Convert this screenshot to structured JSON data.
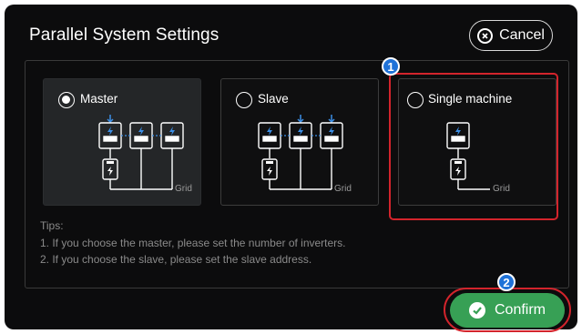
{
  "dialog": {
    "title": "Parallel System Settings",
    "cancel_label": "Cancel",
    "confirm_label": "Confirm"
  },
  "options": [
    {
      "label": "Master",
      "selected": true,
      "grid_label": "Grid",
      "inverters": 3
    },
    {
      "label": "Slave",
      "selected": false,
      "grid_label": "Grid",
      "inverters": 3
    },
    {
      "label": "Single machine",
      "selected": false,
      "grid_label": "Grid",
      "inverters": 1
    }
  ],
  "tips": {
    "heading": "Tips:",
    "line1": "1. If you choose the master, please set the number of inverters.",
    "line2": "2. If you choose the slave, please set the slave address."
  },
  "annotations": {
    "badge1": "1",
    "badge2": "2"
  },
  "colors": {
    "background": "#0c0c0d",
    "highlight": "#d3242c",
    "badge": "#1f72d8",
    "confirm": "#37a055",
    "icon_blue": "#3c8fe6"
  }
}
